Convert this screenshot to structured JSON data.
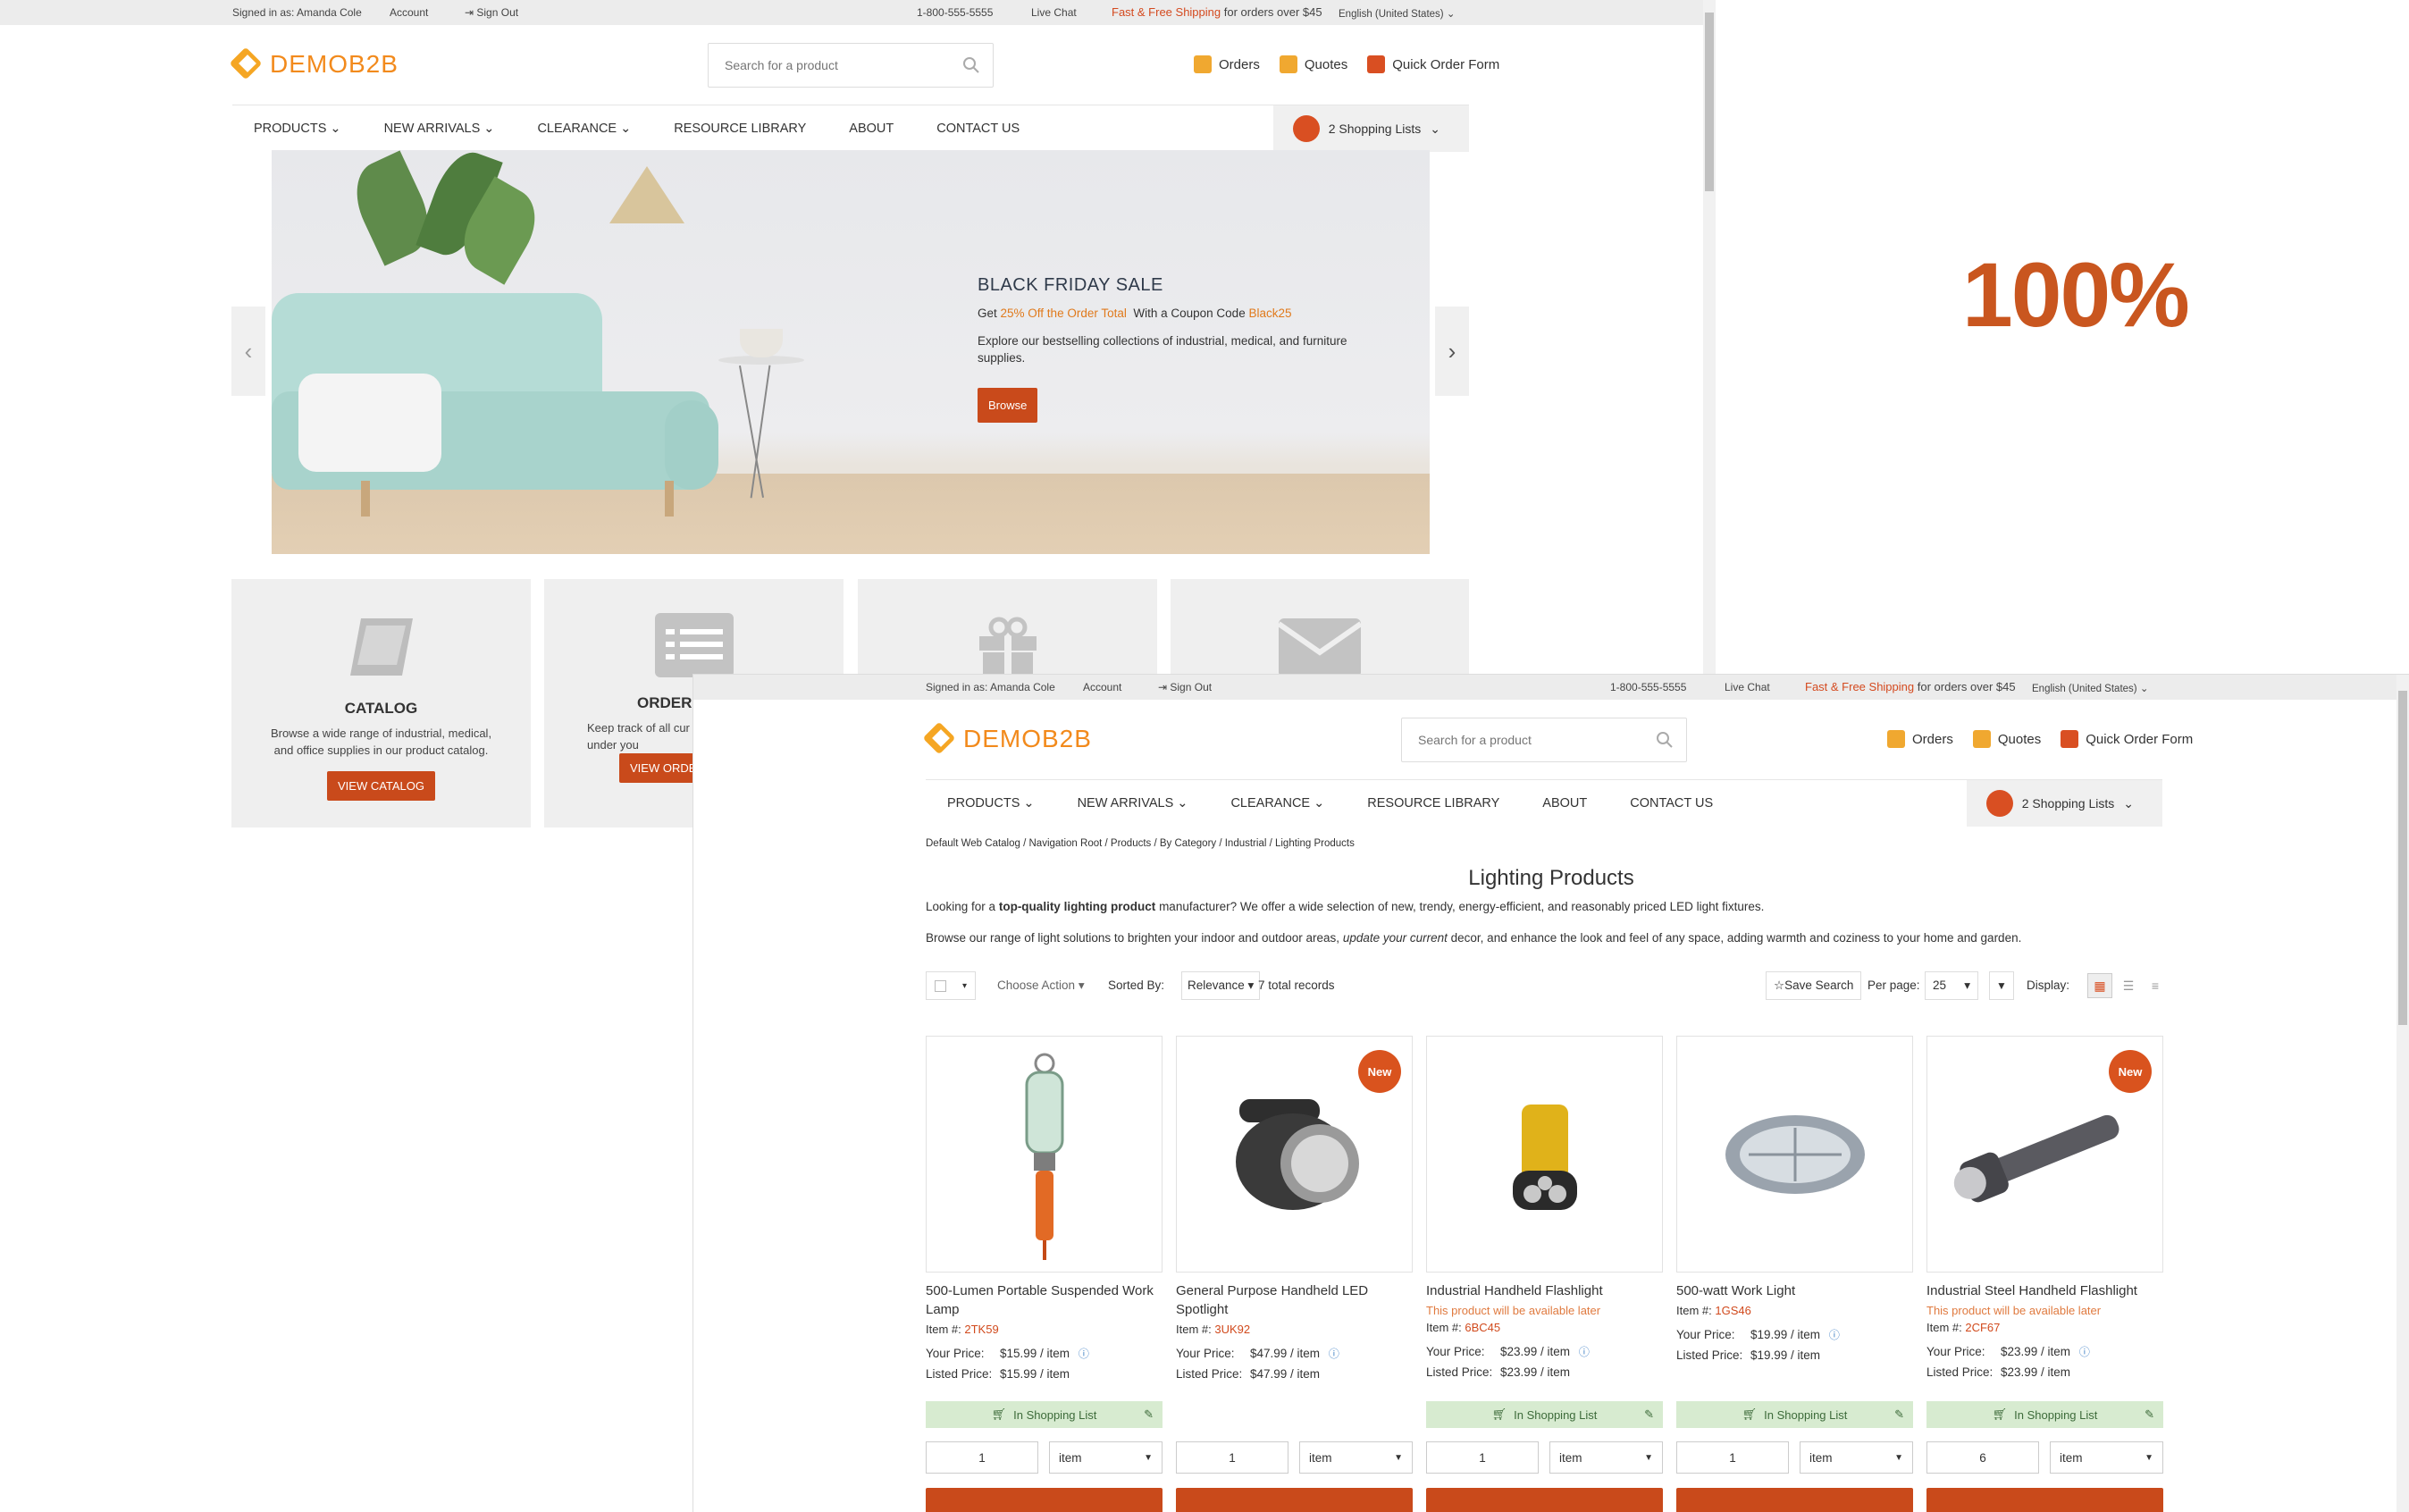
{
  "topbar": {
    "signed_in": "Signed in as: Amanda Cole",
    "account": "Account",
    "sign_out": "Sign Out",
    "phone": "1-800-555-5555",
    "live_chat": "Live Chat",
    "shipping_highlight": "Fast & Free Shipping",
    "shipping_rest": "for orders over $45",
    "language": "English (United States)"
  },
  "logo": {
    "text": "DEMOB2B"
  },
  "search": {
    "placeholder": "Search for a product"
  },
  "header_links": {
    "orders": "Orders",
    "quotes": "Quotes",
    "quick_order": "Quick Order Form"
  },
  "nav": {
    "products": "PRODUCTS",
    "new_arrivals": "NEW ARRIVALS",
    "clearance": "CLEARANCE",
    "resource_library": "RESOURCE LIBRARY",
    "about": "ABOUT",
    "contact": "CONTACT US",
    "shopping_lists": "2 Shopping Lists"
  },
  "hero": {
    "title": "BLACK FRIDAY SALE",
    "line_prefix": "Get",
    "line_highlight": "25% Off the Order Total",
    "line_mid": "With a Coupon Code",
    "coupon": "Black25",
    "description": "Explore our bestselling collections of industrial, medical, and furniture supplies.",
    "button": "Browse"
  },
  "tiles": {
    "catalog_title": "CATALOG",
    "catalog_text": "Browse a wide range of industrial, medical, and office supplies in our product catalog.",
    "catalog_button": "VIEW CATALOG",
    "order_title": "ORDER H",
    "order_text": "Keep track of all cur orders under you",
    "order_button": "VIEW ORDE"
  },
  "zoom_label": "100%",
  "page": {
    "breadcrumb": "Default Web Catalog / Navigation Root / Products / By Category / Industrial / Lighting Products",
    "title": "Lighting Products",
    "intro_pre": "Looking for a",
    "intro_bold": "top-quality lighting product",
    "intro_post": "manufacturer? We offer a wide selection of new, trendy, energy-efficient, and reasonably priced LED light fixtures.",
    "intro2_pre": "Browse our range of light solutions to brighten your indoor and outdoor areas,",
    "intro2_italic": "update your current",
    "intro2_post": "decor, and enhance the look and feel of any space, adding warmth and coziness to your home and garden."
  },
  "toolbar": {
    "choose_action": "Choose Action",
    "sorted_by": "Sorted By:",
    "sort_value": "Relevance",
    "records": "7 total records",
    "save_search": "Save Search",
    "per_page": "Per page:",
    "per_page_value": "25",
    "display": "Display:"
  },
  "products": [
    {
      "name": "500-Lumen Portable Suspended Work Lamp",
      "sku_label": "Item #:",
      "sku": "2TK59",
      "warn": "",
      "your_price": "$15.99 / item",
      "listed_price": "$15.99 / item",
      "badge": "",
      "in_list": "In Shopping List",
      "qty": "1",
      "unit": "item"
    },
    {
      "name": "General Purpose Handheld LED Spotlight",
      "sku_label": "Item #:",
      "sku": "3UK92",
      "warn": "",
      "your_price": "$47.99 / item",
      "listed_price": "$47.99 / item",
      "badge": "New",
      "in_list": "",
      "qty": "1",
      "unit": "item"
    },
    {
      "name": "Industrial Handheld Flashlight",
      "sku_label": "Item #:",
      "sku": "6BC45",
      "warn": "This product will be available later",
      "your_price": "$23.99 / item",
      "listed_price": "$23.99 / item",
      "badge": "",
      "in_list": "In Shopping List",
      "qty": "1",
      "unit": "item"
    },
    {
      "name": "500-watt Work Light",
      "sku_label": "Item #:",
      "sku": "1GS46",
      "warn": "",
      "your_price": "$19.99 / item",
      "listed_price": "$19.99 / item",
      "badge": "",
      "in_list": "In Shopping List",
      "qty": "1",
      "unit": "item"
    },
    {
      "name": "Industrial Steel Handheld Flashlight",
      "sku_label": "Item #:",
      "sku": "2CF67",
      "warn": "This product will be available later",
      "your_price": "$23.99 / item",
      "listed_price": "$23.99 / item",
      "badge": "New",
      "in_list": "In Shopping List",
      "qty": "6",
      "unit": "item"
    }
  ],
  "labels": {
    "your_price": "Your Price:",
    "listed_price": "Listed Price:"
  },
  "colors": {
    "accent": "#d94f22",
    "brand": "#f28a1c",
    "list_green": "#d7ebd0"
  }
}
